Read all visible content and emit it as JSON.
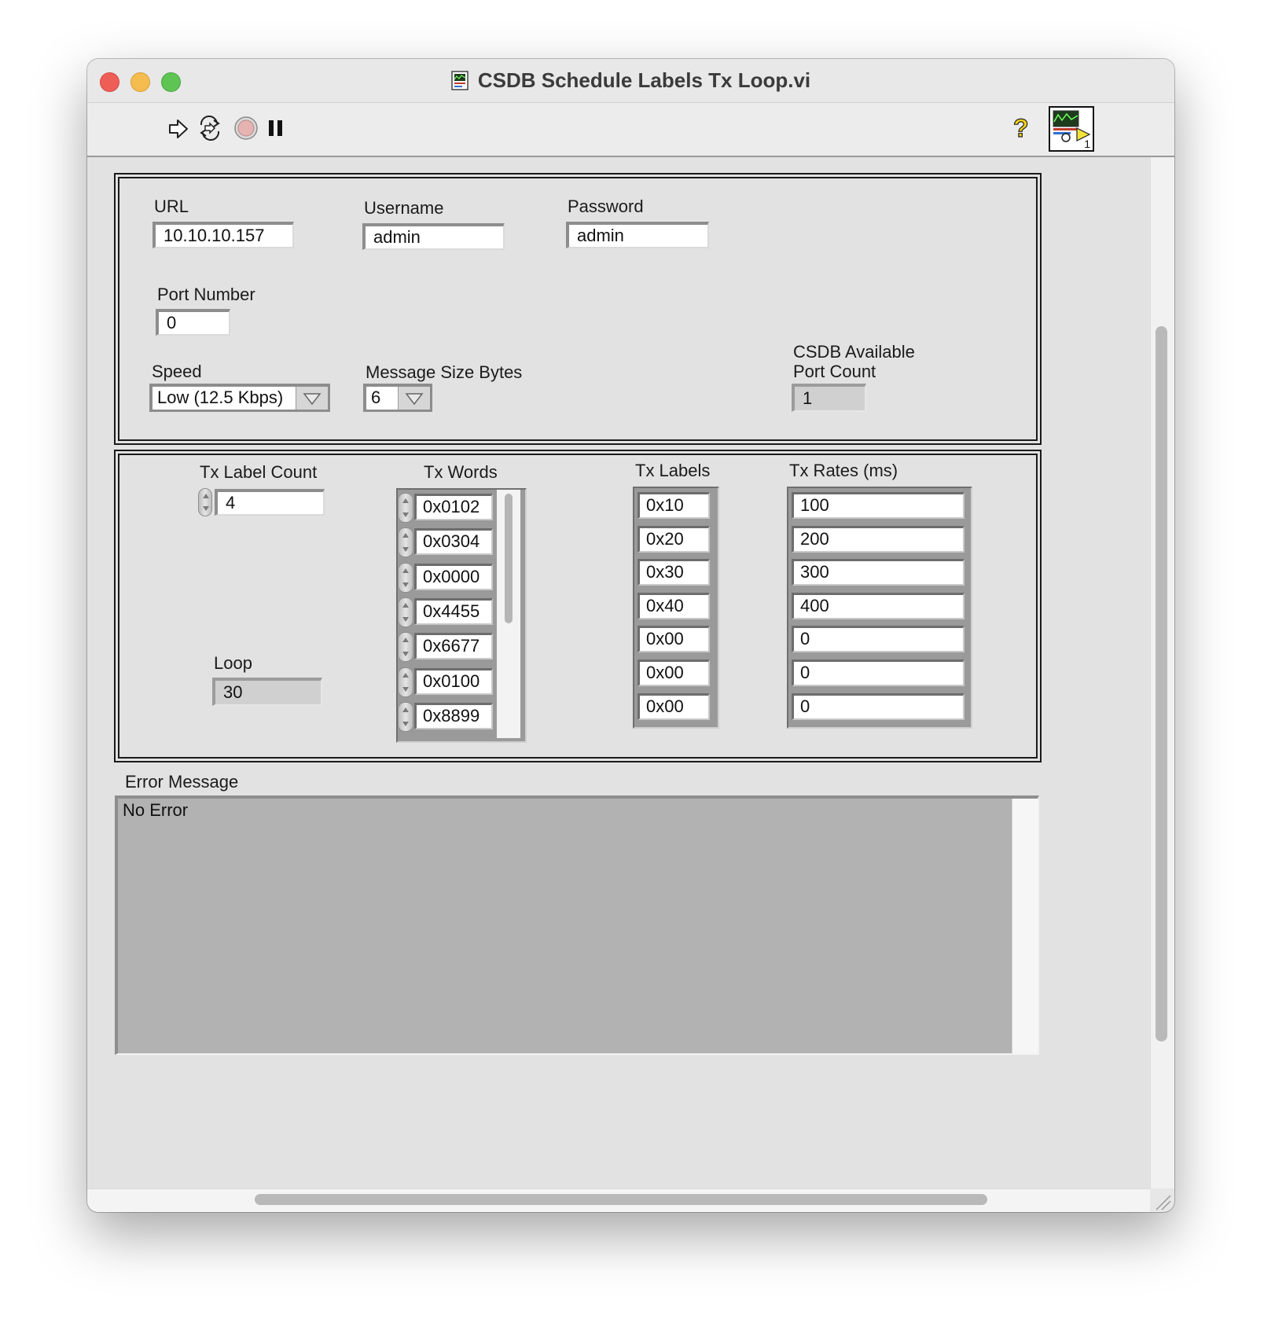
{
  "window": {
    "title": "CSDB Schedule Labels Tx Loop.vi"
  },
  "colors": {
    "close": "#ee5e57",
    "minimize": "#f5bd4f",
    "zoom": "#5ec454"
  },
  "toolbar": {
    "icons": [
      "run-arrow-icon",
      "run-continuously-icon",
      "abort-execution-icon",
      "pause-icon",
      "context-help-icon",
      "vi-icon"
    ],
    "vi_icon_number": "1"
  },
  "connection": {
    "url": {
      "label": "URL",
      "value": "10.10.10.157"
    },
    "username": {
      "label": "Username",
      "value": "admin"
    },
    "password": {
      "label": "Password",
      "value": "admin"
    },
    "port_number": {
      "label": "Port Number",
      "value": "0"
    },
    "speed": {
      "label": "Speed",
      "value": "Low (12.5 Kbps)"
    },
    "message_size": {
      "label": "Message Size Bytes",
      "value": "6"
    },
    "available_ports": {
      "label_line1": "CSDB Available",
      "label_line2": "Port Count",
      "value": "1"
    }
  },
  "tx": {
    "label_count": {
      "label": "Tx Label Count",
      "value": "4"
    },
    "loop": {
      "label": "Loop",
      "value": "30"
    },
    "words": {
      "label": "Tx Words",
      "values": [
        "0x0102",
        "0x0304",
        "0x0000",
        "0x4455",
        "0x6677",
        "0x0100",
        "0x8899"
      ]
    },
    "labels": {
      "label": "Tx Labels",
      "values": [
        "0x10",
        "0x20",
        "0x30",
        "0x40",
        "0x00",
        "0x00",
        "0x00"
      ]
    },
    "rates": {
      "label": "Tx Rates (ms)",
      "values": [
        "100",
        "200",
        "300",
        "400",
        "0",
        "0",
        "0"
      ]
    }
  },
  "error": {
    "label": "Error Message",
    "value": "No Error"
  }
}
